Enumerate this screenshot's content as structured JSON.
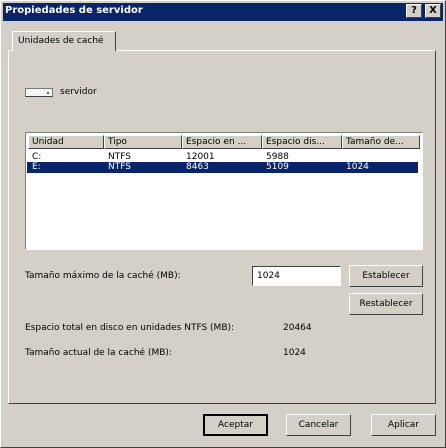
{
  "window": {
    "title": "Propiedades de servidor",
    "help_btn": "?",
    "close_btn": "X"
  },
  "tabs": [
    {
      "label": "Unidades de caché"
    }
  ],
  "server": {
    "name": "servidor"
  },
  "list": {
    "columns": [
      "Unidad",
      "Tipo",
      "Espacio en ...",
      "Espacio dis...",
      "Tamaño de..."
    ],
    "rows": [
      [
        "C:",
        "NTFS",
        "12001",
        "5988",
        ""
      ],
      [
        "E:",
        "NTFS",
        "8463",
        "5109",
        "1024"
      ]
    ],
    "selected_row": 1
  },
  "max_cache": {
    "label": "Tamaño máximo de la caché (MB):",
    "value": "1024"
  },
  "buttons": {
    "set": "Establecer",
    "reset": "Restablecer",
    "ok": "Aceptar",
    "cancel": "Cancelar",
    "apply": "Aplicar"
  },
  "total_space": {
    "label": "Espacio total en disco en unidades NTFS (MB):",
    "value": "20464"
  },
  "current_cache": {
    "label": "Tamaño actual de la caché (MB):",
    "value": "1024"
  }
}
